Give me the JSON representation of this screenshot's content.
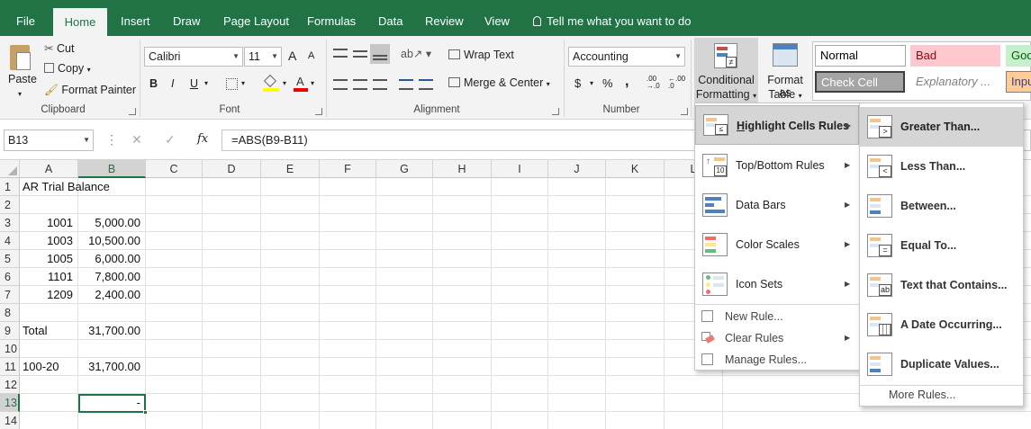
{
  "tabs": [
    "File",
    "Home",
    "Insert",
    "Draw",
    "Page Layout",
    "Formulas",
    "Data",
    "Review",
    "View"
  ],
  "tell_me": "Tell me what you want to do",
  "clipboard": {
    "paste": "Paste",
    "cut": "Cut",
    "copy": "Copy",
    "format_painter": "Format Painter",
    "group": "Clipboard"
  },
  "font": {
    "name": "Calibri",
    "size": "11",
    "bold": "B",
    "italic": "I",
    "underline": "U",
    "grow": "A",
    "shrink": "A",
    "group": "Font"
  },
  "alignment": {
    "wrap": "Wrap Text",
    "merge": "Merge & Center",
    "group": "Alignment"
  },
  "number": {
    "format": "Accounting",
    "currency": "$",
    "percent": "%",
    "comma": ",",
    "inc": ".00 →.0",
    "dec": "←.00 .0",
    "group": "Number"
  },
  "styles": {
    "conditional_formatting": "Conditional Formatting",
    "cf_line1": "Conditional",
    "cf_line2": "Formatting",
    "format_as_table_line1": "Format as",
    "format_as_table_line2": "Table",
    "cells": [
      {
        "text": "Normal",
        "bg": "#ffffff",
        "fg": "#000000",
        "border": "#a6a6a6"
      },
      {
        "text": "Bad",
        "bg": "#ffc7ce",
        "fg": "#9c0006",
        "border": "#ffc7ce"
      },
      {
        "text": "Goo",
        "bg": "#c6efce",
        "fg": "#006100",
        "border": "#c6efce"
      },
      {
        "text": "Check Cell",
        "bg": "#a5a5a5",
        "fg": "#ffffff",
        "border": "#3f3f3f"
      },
      {
        "text": "Explanatory ...",
        "bg": "#ffffff",
        "fg": "#7f7f7f",
        "border": "#ffffff"
      },
      {
        "text": "Inpu",
        "bg": "#ffcc99",
        "fg": "#3f3f76",
        "border": "#7f7f7f"
      }
    ]
  },
  "formula_bar": {
    "name_box": "B13",
    "cancel": "✕",
    "enter": "✓",
    "fx": "fx",
    "formula": "=ABS(B9-B11)"
  },
  "columns": [
    "A",
    "B",
    "C",
    "D",
    "E",
    "F",
    "G",
    "H",
    "I",
    "J",
    "K",
    "L"
  ],
  "rows": [
    "1",
    "2",
    "3",
    "4",
    "5",
    "6",
    "7",
    "8",
    "9",
    "10",
    "11",
    "12",
    "13",
    "14"
  ],
  "cells": {
    "A1": "AR Trial Balance",
    "A3": "1001",
    "B3": "5,000.00",
    "A4": "1003",
    "B4": "10,500.00",
    "A5": "1005",
    "B5": "6,000.00",
    "A6": "1101",
    "B6": "7,800.00",
    "A7": "1209",
    "B7": "2,400.00",
    "A9": "Total",
    "B9": "31,700.00",
    "A11": "100-20",
    "B11": "31,700.00",
    "B13": "-"
  },
  "cf_menu": {
    "highlight": "Highlight Cells Rules",
    "topbottom": "Top/Bottom Rules",
    "databars": "Data Bars",
    "colorscales": "Color Scales",
    "iconsets": "Icon Sets",
    "new_rule": "New Rule...",
    "clear_rules": "Clear Rules",
    "manage_rules": "Manage Rules...",
    "topbottom_icon_text": "10"
  },
  "hl_menu": {
    "greater": "Greater Than...",
    "less": "Less Than...",
    "between": "Between...",
    "equal": "Equal To...",
    "text": "Text that Contains...",
    "date": "A Date Occurring...",
    "duplicate": "Duplicate Values...",
    "more": "More Rules...",
    "icon_greater": ">",
    "icon_less": "<",
    "icon_equal": "=",
    "icon_text": "ab"
  },
  "colors": {
    "excel_green": "#217346",
    "ribbon_bg": "#f3f3f3",
    "highlight": "#d5d5d5",
    "selection": "#217346"
  }
}
